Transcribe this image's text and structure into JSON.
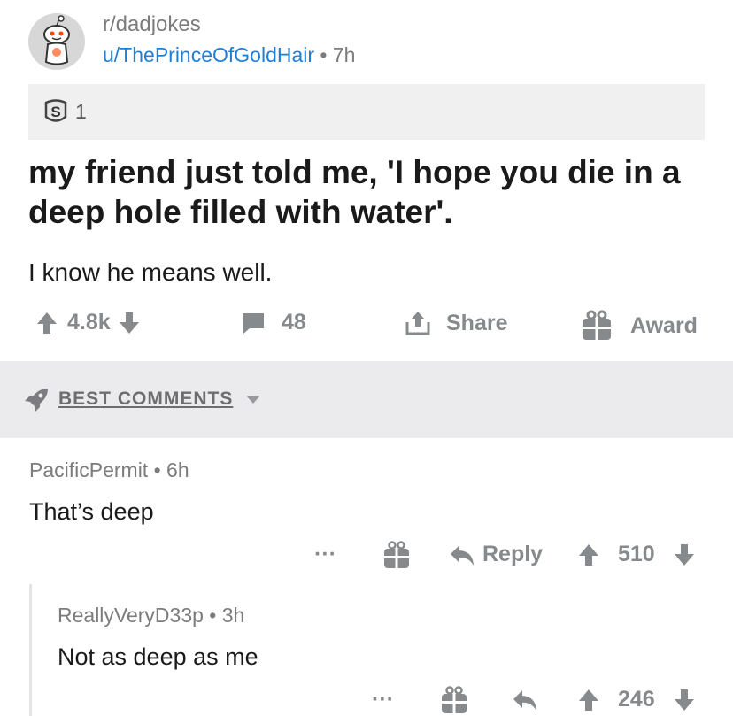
{
  "post": {
    "subreddit": "r/dadjokes",
    "author": "u/ThePrinceOfGoldHair",
    "separator": " • ",
    "time": "7h",
    "award_count": "1",
    "title": "my friend just told me, 'I hope you die in a deep hole filled with water'.",
    "body": "I know he means well.",
    "score": "4.8k",
    "comments": "48",
    "share_label": "Share",
    "award_label": "Award"
  },
  "sort": {
    "label": "BEST COMMENTS"
  },
  "comments": [
    {
      "author": "PacificPermit",
      "time": "6h",
      "text": "That’s deep",
      "more": "···",
      "reply_label": "Reply",
      "score": "510"
    },
    {
      "author": "ReallyVeryD33p",
      "time": "3h",
      "text": "Not as deep as me",
      "more": "···",
      "score": "246"
    }
  ],
  "colors": {
    "link": "#1f7fd6",
    "meta": "#7c7c7c",
    "action": "#878a8c",
    "sort_bar": "#ebebed"
  }
}
